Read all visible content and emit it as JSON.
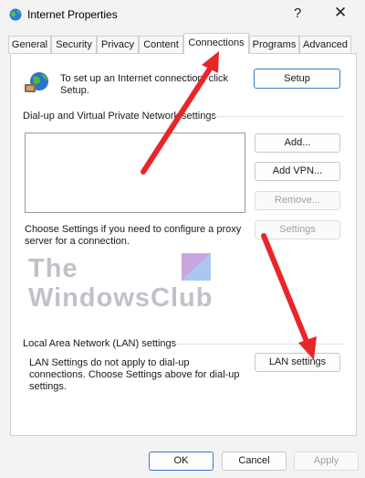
{
  "window": {
    "title": "Internet Properties",
    "help_label": "?",
    "close_label": "✕"
  },
  "tabs": [
    {
      "label": "General"
    },
    {
      "label": "Security"
    },
    {
      "label": "Privacy"
    },
    {
      "label": "Content"
    },
    {
      "label": "Connections",
      "active": true
    },
    {
      "label": "Programs"
    },
    {
      "label": "Advanced"
    }
  ],
  "setup": {
    "text": "To set up an Internet connection, click Setup.",
    "button": "Setup"
  },
  "dialup": {
    "group_label": "Dial-up and Virtual Private Network settings",
    "add_button": "Add...",
    "add_vpn_button": "Add VPN...",
    "remove_button": "Remove...",
    "settings_text": "Choose Settings if you need to configure a proxy server for a connection.",
    "settings_button": "Settings"
  },
  "watermark": {
    "line1": "The",
    "line2": "WindowsClub"
  },
  "lan": {
    "group_label": "Local Area Network (LAN) settings",
    "text": "LAN Settings do not apply to dial-up connections. Choose Settings above for dial-up settings.",
    "button": "LAN settings"
  },
  "footer": {
    "ok": "OK",
    "cancel": "Cancel",
    "apply": "Apply"
  },
  "colors": {
    "accent_border": "#3c79c9",
    "annotation_arrow": "#e8262a"
  }
}
